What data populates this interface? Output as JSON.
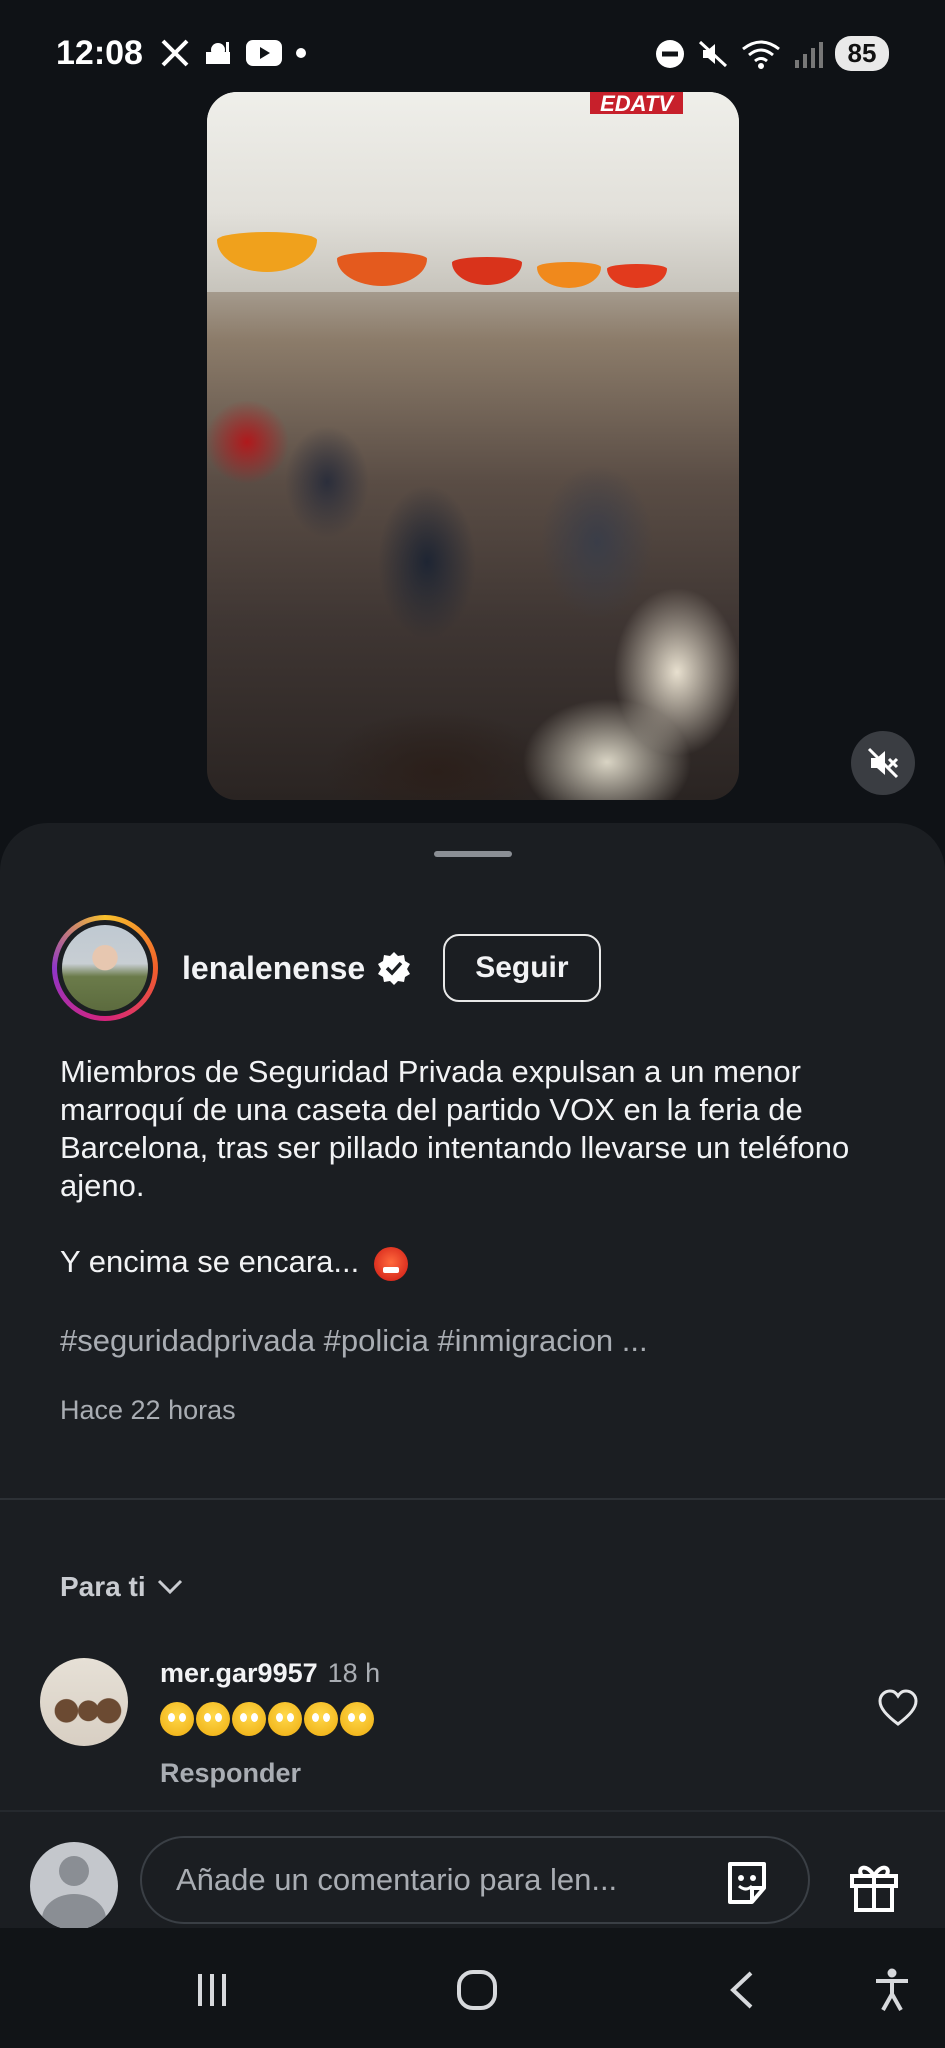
{
  "status_bar": {
    "time": "12:08",
    "battery": "85",
    "left_icons": [
      "x-app-icon",
      "mosque-icon",
      "youtube-icon",
      "dot-icon"
    ],
    "right_icons": [
      "dnd-icon",
      "mute-icon",
      "wifi-icon",
      "signal-icon"
    ]
  },
  "video": {
    "overlay_tag": "EDATV",
    "mute_icon": "volume-off-icon"
  },
  "post": {
    "author": "lenalenense",
    "verified": true,
    "follow_label": "Seguir",
    "caption": "Miembros de Seguridad Privada expulsan a un menor marroquí de una caseta del partido VOX en la feria de Barcelona, tras ser pillado intentando llevarse un teléfono ajeno.",
    "caption_line2": "Y encima se encara...",
    "hashtags": "#seguridadprivada #policia #inmigracion ...",
    "timestamp": "Hace 22 horas"
  },
  "comments_section": {
    "sort_label": "Para ti",
    "comments": [
      {
        "user": "mer.gar9957",
        "time": "18 h",
        "emoji_count": 6,
        "reply_label": "Responder"
      }
    ]
  },
  "comment_bar": {
    "placeholder": "Añade un comentario para len..."
  },
  "colors": {
    "background": "#0f1216",
    "sheet": "#1b1e22",
    "text_primary": "#f2f3f5",
    "text_secondary": "#a9adb3",
    "accent_verified": "#ffffff"
  }
}
